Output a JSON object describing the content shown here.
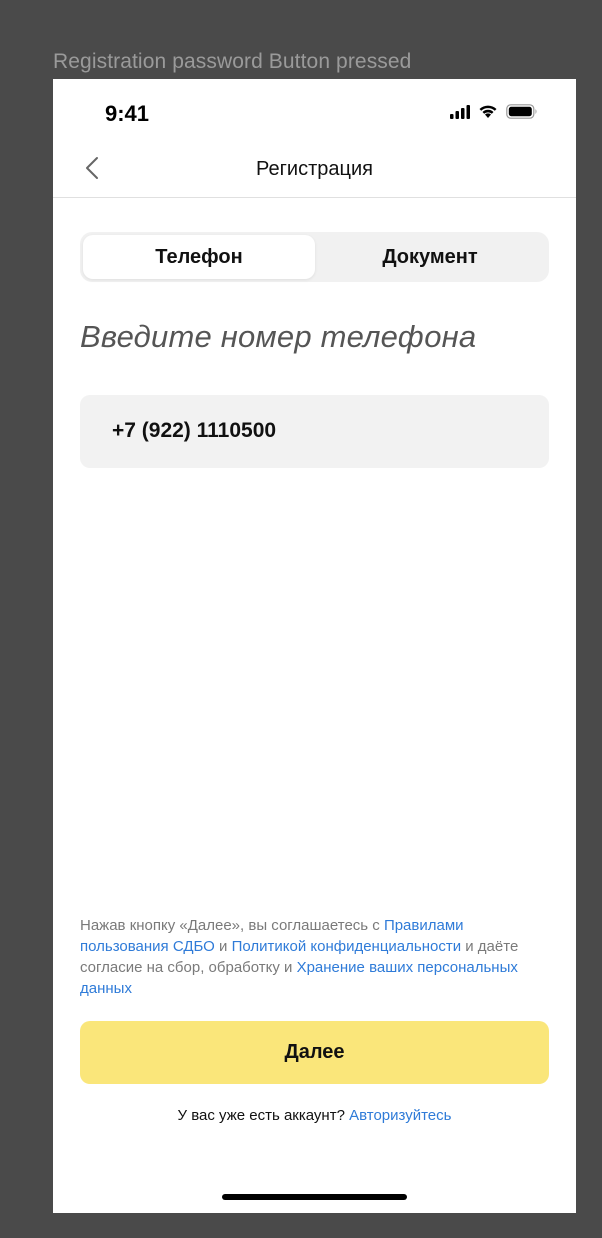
{
  "frame_label": "Registration password Button pressed",
  "status_bar": {
    "time": "9:41",
    "icons": [
      "signal-icon",
      "wifi-icon",
      "battery-icon"
    ]
  },
  "navbar": {
    "back_icon": "chevron-left-icon",
    "title": "Регистрация"
  },
  "tabs": [
    {
      "label": "Телефон",
      "active": true
    },
    {
      "label": "Документ",
      "active": false
    }
  ],
  "heading": "Введите номер телефона",
  "phone_input": {
    "value": "+7 (922) 1110500"
  },
  "legal": {
    "text_1": "Нажав кнопку «Далее», вы соглашаетесь с ",
    "link_1": "Правилами пользования СДБО",
    "text_2": " и ",
    "link_2": "Политикой конфиденциальности",
    "text_3": " и даёте согласие на сбор, обработку и ",
    "link_3": "Хранение ваших персональных данных"
  },
  "next_button": {
    "label": "Далее"
  },
  "login_prompt": {
    "text": "У вас уже есть аккаунт? ",
    "link": "Авторизуйтесь"
  },
  "colors": {
    "accent_button": "#fae67a",
    "link": "#2f7bd8",
    "background": "#4a4a4a"
  }
}
